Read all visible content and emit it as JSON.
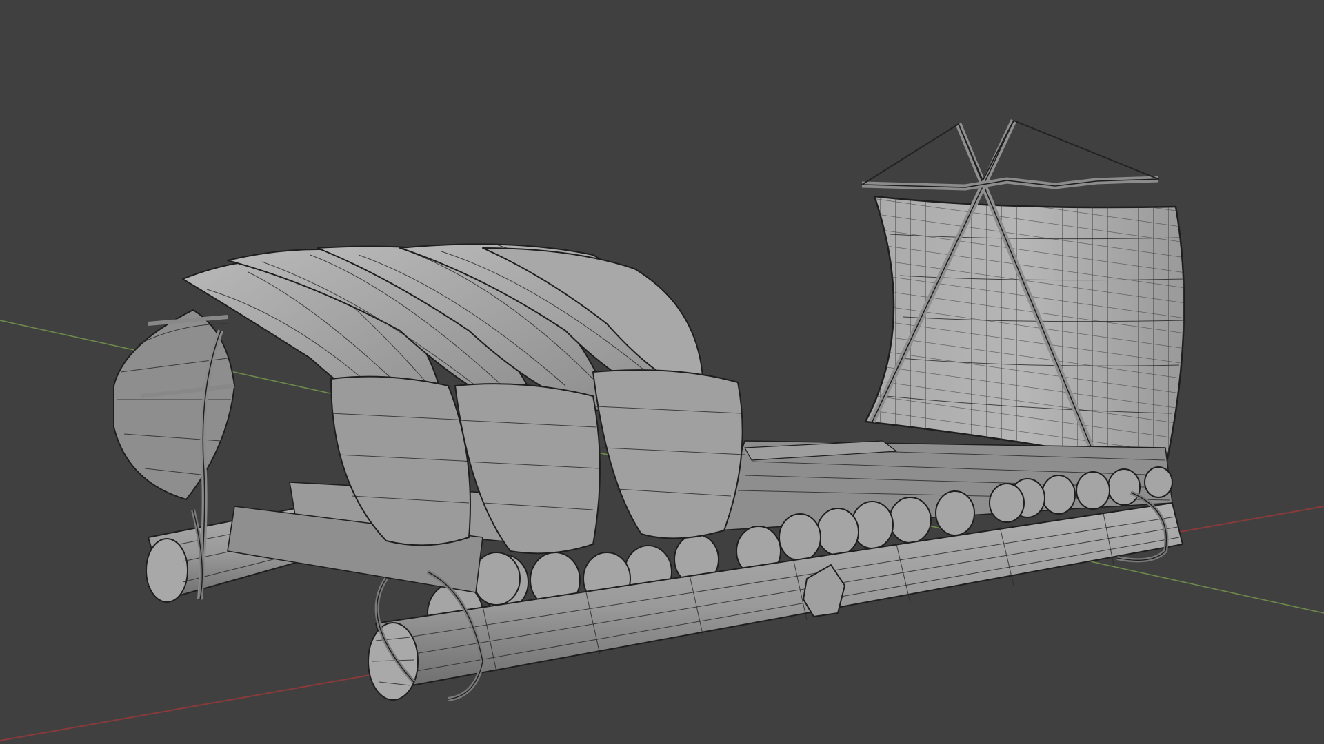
{
  "viewport": {
    "background_color": "#404040",
    "mesh_fill": "#9c9c9c",
    "mesh_shade": "#7e7e7e",
    "mesh_light": "#b4b4b4",
    "wire_color": "#1e1e1e",
    "x_axis_color": "#8a3a3a",
    "y_axis_color": "#6e8a4a"
  },
  "scene": {
    "object": "raft-with-sail-and-leaf-shelter",
    "shading": "solid-with-wireframe-overlay"
  }
}
